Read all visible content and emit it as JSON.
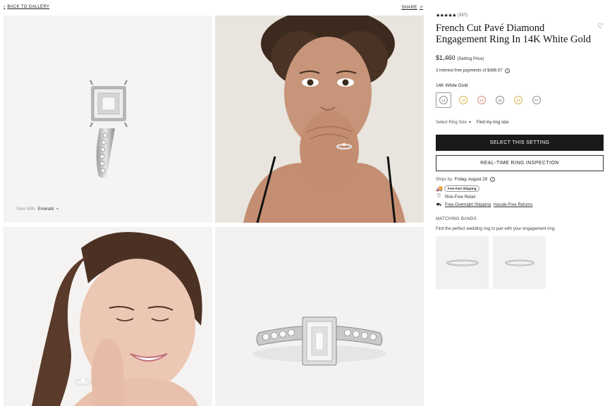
{
  "nav": {
    "back_label": "BACK TO GALLERY",
    "share_label": "SHARE"
  },
  "gallery": {
    "view_with_label": "View With",
    "view_with_value": "Emerald"
  },
  "product": {
    "rating_stars": "★★★★★",
    "review_count": "(337)",
    "title": "French Cut Pavé Diamond Engagement Ring In 14K White Gold",
    "price": "$1,460",
    "price_note": "(Setting Price)",
    "interest_text": "3 interest-free payments of $486.67",
    "metal_label": "14K White Gold",
    "metals": [
      {
        "code": "14",
        "color": "#8f8f8f",
        "selected": true
      },
      {
        "code": "14",
        "color": "#d9b44a"
      },
      {
        "code": "14",
        "color": "#e08b7d"
      },
      {
        "code": "18",
        "color": "#8f8f8f"
      },
      {
        "code": "18",
        "color": "#d9b44a"
      },
      {
        "code": "PT",
        "color": "#8f8f8f"
      }
    ],
    "ring_size_label": "Select Ring Size",
    "find_size_label": "Find my ring size",
    "select_button": "SELECT THIS SETTING",
    "inspection_button": "REAL-TIME RING INSPECTION",
    "ships_by_label": "Ships by:",
    "ships_by_date": "Friday, August 29",
    "fast_shipping_badge": "Free Fast Shipping",
    "risk_free": "Risk-Free Retail",
    "overnight_shipping": "Free Overnight Shipping",
    "hassle_free": "Hassle-Free Returns"
  },
  "matching": {
    "title": "MATCHING BANDS",
    "subtitle": "Find the perfect wedding ring to pair with your engagement ring."
  },
  "colors": {
    "primary_button": "#1a1a1a",
    "accent_gold": "#d9b44a",
    "accent_rose": "#e08b7d"
  }
}
